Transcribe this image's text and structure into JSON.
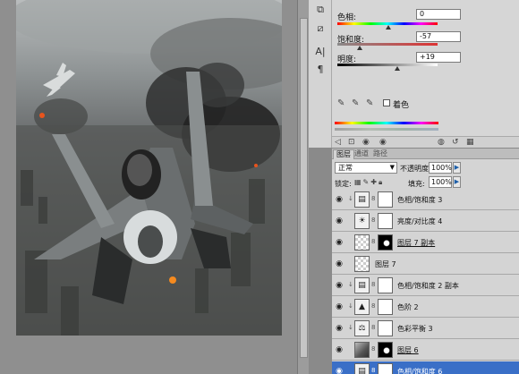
{
  "adjustments": {
    "hue_label": "色相:",
    "hue_value": "0",
    "saturation_label": "饱和度:",
    "saturation_value": "-57",
    "lightness_label": "明度:",
    "lightness_value": "+19",
    "colorize_label": "着色"
  },
  "layers_panel": {
    "tabs": [
      "图层",
      "通道",
      "路径"
    ],
    "blend_mode": "正常",
    "opacity_label": "不透明度:",
    "opacity_value": "100%",
    "lock_label": "锁定:",
    "fill_label": "填充:",
    "fill_value": "100%",
    "layers": [
      {
        "name": "色相/饱和度 3",
        "thumb": "hue-sat-icon",
        "mask": "white"
      },
      {
        "name": "亮度/对比度 4",
        "thumb": "brightness-icon",
        "mask": "white"
      },
      {
        "name": "图层 7 副本",
        "thumb": "checker",
        "mask": "dark"
      },
      {
        "name": "图层 7",
        "thumb": "checker",
        "mask": "none"
      },
      {
        "name": "色相/饱和度 2 副本",
        "thumb": "hue-sat-icon",
        "mask": "white"
      },
      {
        "name": "色阶 2",
        "thumb": "levels-icon",
        "mask": "white"
      },
      {
        "name": "色彩平衡 3",
        "thumb": "balance-icon",
        "mask": "white"
      },
      {
        "name": "图层 6",
        "thumb": "photo",
        "mask": "dark"
      },
      {
        "name": "色相/饱和度 6",
        "thumb": "hue-sat-icon",
        "mask": "white"
      }
    ]
  },
  "colors": {
    "selection": "#3a6fc7",
    "panel": "#d4d4d4",
    "accent": "#1e5fa8"
  }
}
